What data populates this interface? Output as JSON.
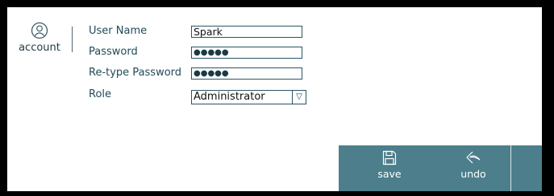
{
  "sidebar": {
    "account_label": "account",
    "icon": "account-icon"
  },
  "form": {
    "username": {
      "label": "User Name",
      "value": "Spark"
    },
    "password": {
      "label": "Password",
      "value": "●●●●●"
    },
    "retype_password": {
      "label": "Re-type Password",
      "value": "●●●●●"
    },
    "role": {
      "label": "Role",
      "value": "Administrator"
    }
  },
  "actions": {
    "save_label": "save",
    "undo_label": "undo",
    "save_icon": "save-icon",
    "undo_icon": "undo-icon"
  },
  "colors": {
    "accent": "#4c7e8b",
    "text": "#1f4a57",
    "frame": "#000000"
  }
}
